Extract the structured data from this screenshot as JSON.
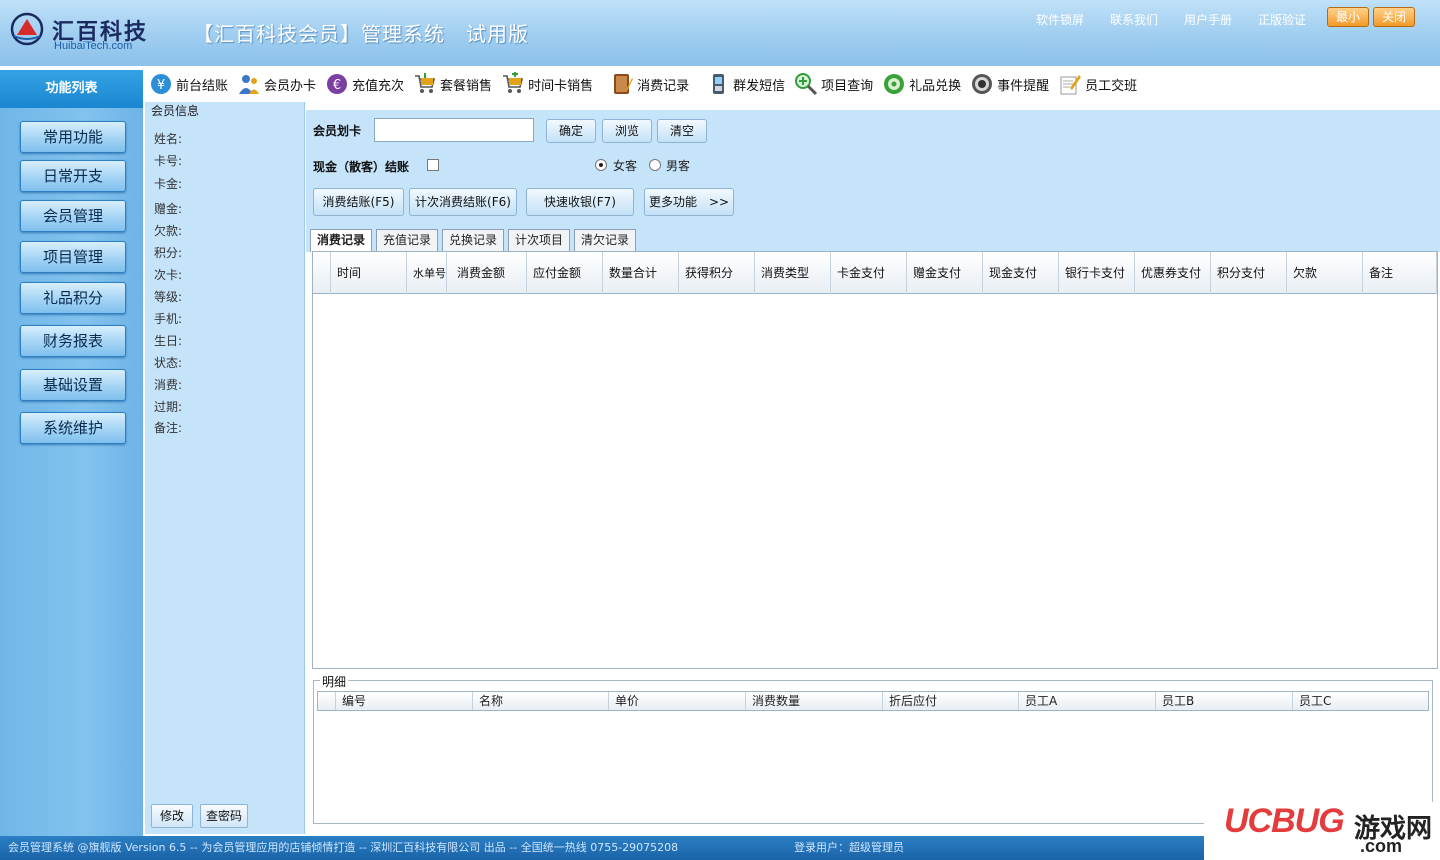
{
  "header": {
    "logo_cn": "汇百科技",
    "logo_en": "HuibaiTech.com",
    "title": "【汇百科技会员】管理系统　试用版",
    "links": [
      "软件锁屏",
      "联系我们",
      "用户手册",
      "正版验证"
    ],
    "min_label": "最小",
    "close_label": "关闭"
  },
  "toolbar": {
    "items": [
      {
        "label": "前台结账",
        "icon": "yen-coin-icon",
        "color": "#2d8ed8"
      },
      {
        "label": "会员办卡",
        "icon": "users-icon",
        "color": "#3a78c9"
      },
      {
        "label": "充值充次",
        "icon": "euro-coin-icon",
        "color": "#7b3fa0"
      },
      {
        "label": "套餐销售",
        "icon": "cart-icon",
        "color": "#e2a21a"
      },
      {
        "label": "时间卡销售",
        "icon": "cart-add-icon",
        "color": "#e2a21a"
      },
      {
        "label": "消费记录",
        "icon": "notebook-icon",
        "color": "#8b4a1c"
      },
      {
        "label": "群发短信",
        "icon": "phone-icon",
        "color": "#4aa0d8"
      },
      {
        "label": "项目查询",
        "icon": "magnifier-icon",
        "color": "#2f9e3a"
      },
      {
        "label": "礼品兑换",
        "icon": "disc-icon",
        "color": "#3aa13a"
      },
      {
        "label": "事件提醒",
        "icon": "speaker-icon",
        "color": "#444444"
      },
      {
        "label": "员工交班",
        "icon": "pencil-note-icon",
        "color": "#d08a2a"
      }
    ]
  },
  "sidebar": {
    "header": "功能列表",
    "items": [
      "常用功能",
      "日常开支",
      "会员管理",
      "项目管理",
      "礼品积分",
      "财务报表",
      "基础设置",
      "系统维护"
    ]
  },
  "member_info": {
    "title": "会员信息",
    "fields": [
      "姓名:",
      "卡号:",
      "卡金:",
      "赠金:",
      "欠款:",
      "积分:",
      "次卡:",
      "等级:",
      "手机:",
      "生日:",
      "状态:",
      "消费:",
      "过期:",
      "备注:"
    ],
    "modify_label": "修改",
    "check_pwd_label": "查密码"
  },
  "main": {
    "card_label": "会员划卡",
    "card_value": "",
    "confirm_label": "确定",
    "browse_label": "浏览",
    "clear_label": "清空",
    "cash_label": "现金（散客）结账",
    "female_label": "女客",
    "male_label": "男客",
    "gender_selected": "女客",
    "action_buttons": [
      "消费结账(F5)",
      "计次消费结账(F6)",
      "快速收银(F7)",
      "更多功能　>>"
    ]
  },
  "tabs": [
    "消费记录",
    "充值记录",
    "兑换记录",
    "计次项目",
    "清欠记录"
  ],
  "active_tab": "消费记录",
  "grid": {
    "columns": [
      "时间",
      "水单号",
      "消费金额",
      "应付金额",
      "数量合计",
      "获得积分",
      "消费类型",
      "卡金支付",
      "赠金支付",
      "现金支付",
      "银行卡支付",
      "优惠券支付",
      "积分支付",
      "欠款",
      "备注"
    ]
  },
  "detail": {
    "title": "明细",
    "columns": [
      "编号",
      "名称",
      "单价",
      "消费数量",
      "折后应付",
      "员工A",
      "员工B",
      "员工C"
    ]
  },
  "statusbar": {
    "text": "会员管理系统 @旗舰版 Version 6.5 -- 为会员管理应用的店铺倾情打造 -- 深圳汇百科技有限公司 出品 -- 全国统一热线 0755-29075208",
    "user": "登录用户：超级管理员"
  },
  "watermark": {
    "brand": "UCBUG",
    "cn": "游戏网",
    "com": ".com"
  }
}
